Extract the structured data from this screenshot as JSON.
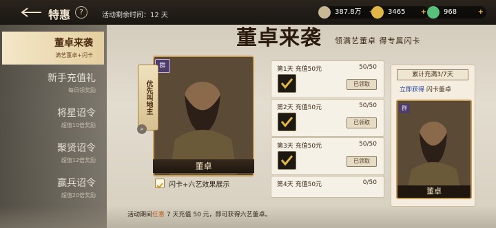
{
  "header": {
    "title": "特惠",
    "help_label": "?",
    "timer_label": "活动剩余时间：12 天",
    "resources": [
      {
        "name": "coin-icon",
        "value": "387.8万",
        "plus": "+",
        "color": "#c8b896"
      },
      {
        "name": "gold-icon",
        "value": "3465",
        "plus": "+",
        "color": "#e2b646"
      },
      {
        "name": "jade-icon",
        "value": "968",
        "plus": "+",
        "color": "#58c07b"
      }
    ]
  },
  "sidebar": {
    "items": [
      {
        "label": "董卓来袭",
        "sub": "满艺董卓+闪卡",
        "active": true
      },
      {
        "label": "新手充值礼",
        "sub": "每日领奖励",
        "active": false
      },
      {
        "label": "将星诏令",
        "sub": "超值10倍奖励",
        "active": false
      },
      {
        "label": "聚贤诏令",
        "sub": "超值12倍奖励",
        "active": false
      },
      {
        "label": "赢兵诏令",
        "sub": "超值20倍奖励",
        "active": false
      }
    ]
  },
  "banner": {
    "title": "董卓来袭",
    "subtitle": "领满艺董卓  得专属闪卡"
  },
  "hero_card": {
    "name": "董卓",
    "faction": "群",
    "tag": "优先叫地主",
    "show_effect_label": "闪卡+六艺效果展示"
  },
  "tasks": [
    {
      "title": "第1天 充值50元",
      "progress": "50/50",
      "status": "已领取"
    },
    {
      "title": "第2天 充值50元",
      "progress": "50/50",
      "status": "已领取"
    },
    {
      "title": "第3天 充值50元",
      "progress": "50/50",
      "status": "已领取"
    },
    {
      "title": "第4天 充值50元",
      "progress": "0/50",
      "status": ""
    }
  ],
  "cumulative": {
    "title": "累计充满3/7天",
    "prefix": "立即获得",
    "reward": "闪卡董卓",
    "card_name": "董卓",
    "faction": "群"
  },
  "footer": {
    "text_prefix": "活动期间",
    "highlight": "任意",
    "text_suffix": " 7 天充值 50 元，即可获得六艺董卓。"
  }
}
